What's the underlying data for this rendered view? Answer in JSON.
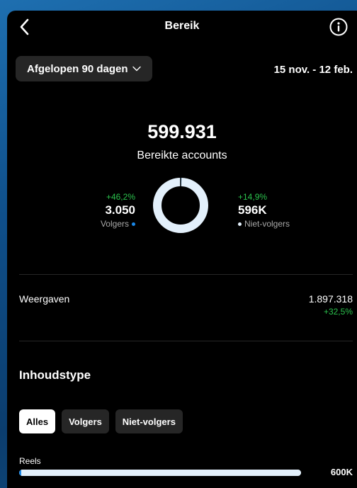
{
  "header": {
    "title": "Bereik",
    "back_icon": "chevron-left-icon",
    "info_icon": "info-circle-icon"
  },
  "filter": {
    "period_label": "Afgelopen 90 dagen",
    "period_chevron": "chevron-down-icon",
    "date_range": "15 nov. - 12 feb."
  },
  "summary": {
    "total": "599.931",
    "total_label": "Bereikte accounts",
    "followers": {
      "change": "+46,2%",
      "value": "3.050",
      "label": "Volgers",
      "color": "#1a88e8",
      "share": 0.005
    },
    "non_followers": {
      "change": "+14,9%",
      "value": "596K",
      "label": "Niet-volgers",
      "color": "#e3f0fb",
      "share": 0.995
    }
  },
  "views": {
    "label": "Weergaven",
    "value": "1.897.318",
    "change": "+32,5%"
  },
  "content_type": {
    "title": "Inhoudstype",
    "tabs": [
      {
        "label": "Alles",
        "active": true
      },
      {
        "label": "Volgers",
        "active": false
      },
      {
        "label": "Niet-volgers",
        "active": false
      }
    ],
    "items": [
      {
        "label": "Reels",
        "value": "600K",
        "fraction": 1.0
      }
    ]
  },
  "colors": {
    "positive": "#2bc24d",
    "followers": "#1a88e8",
    "non_followers": "#e3f0fb"
  }
}
